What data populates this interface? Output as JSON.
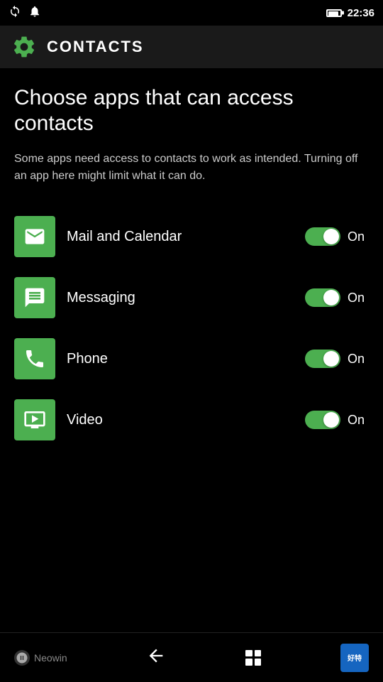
{
  "statusBar": {
    "time": "22:36"
  },
  "header": {
    "title": "CONTACTS"
  },
  "pageTitle": "Choose apps that can access contacts",
  "pageDescription": "Some apps need access to contacts to work as intended. Turning off an app here might limit what it can do.",
  "apps": [
    {
      "id": "mail-calendar",
      "name": "Mail and Calendar",
      "icon": "mail",
      "toggleState": "On"
    },
    {
      "id": "messaging",
      "name": "Messaging",
      "icon": "messaging",
      "toggleState": "On"
    },
    {
      "id": "phone",
      "name": "Phone",
      "icon": "phone",
      "toggleState": "On"
    },
    {
      "id": "video",
      "name": "Video",
      "icon": "video",
      "toggleState": "On"
    }
  ],
  "bottomNav": {
    "brandName": "Neowin"
  }
}
